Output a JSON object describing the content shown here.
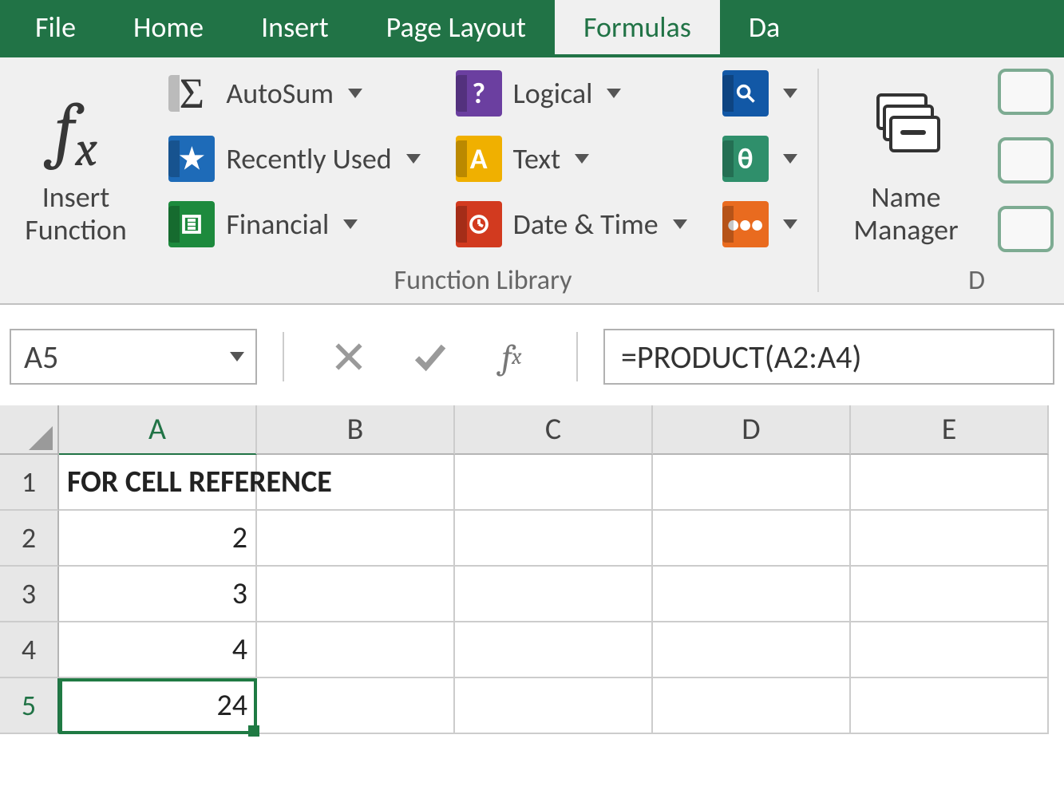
{
  "tabs": {
    "file": "File",
    "home": "Home",
    "insert": "Insert",
    "pagelayout": "Page Layout",
    "formulas": "Formulas",
    "data_partial": "Da"
  },
  "ribbon": {
    "insert_function": "Insert\nFunction",
    "name_manager": "Name\nManager",
    "autosum": "AutoSum",
    "recently_used": "Recently Used",
    "financial": "Financial",
    "logical": "Logical",
    "text": "Text",
    "date_time": "Date & Time",
    "group_function_library": "Function Library",
    "group_defined_partial": "D"
  },
  "namebox": "A5",
  "formula": "=PRODUCT(A2:A4)",
  "columns": [
    "A",
    "B",
    "C",
    "D",
    "E"
  ],
  "rows": [
    "1",
    "2",
    "3",
    "4",
    "5"
  ],
  "cells": {
    "A1": "FOR CELL REFERENCE",
    "A2": "2",
    "A3": "3",
    "A4": "4",
    "A5": "24"
  },
  "active_cell": "A5"
}
